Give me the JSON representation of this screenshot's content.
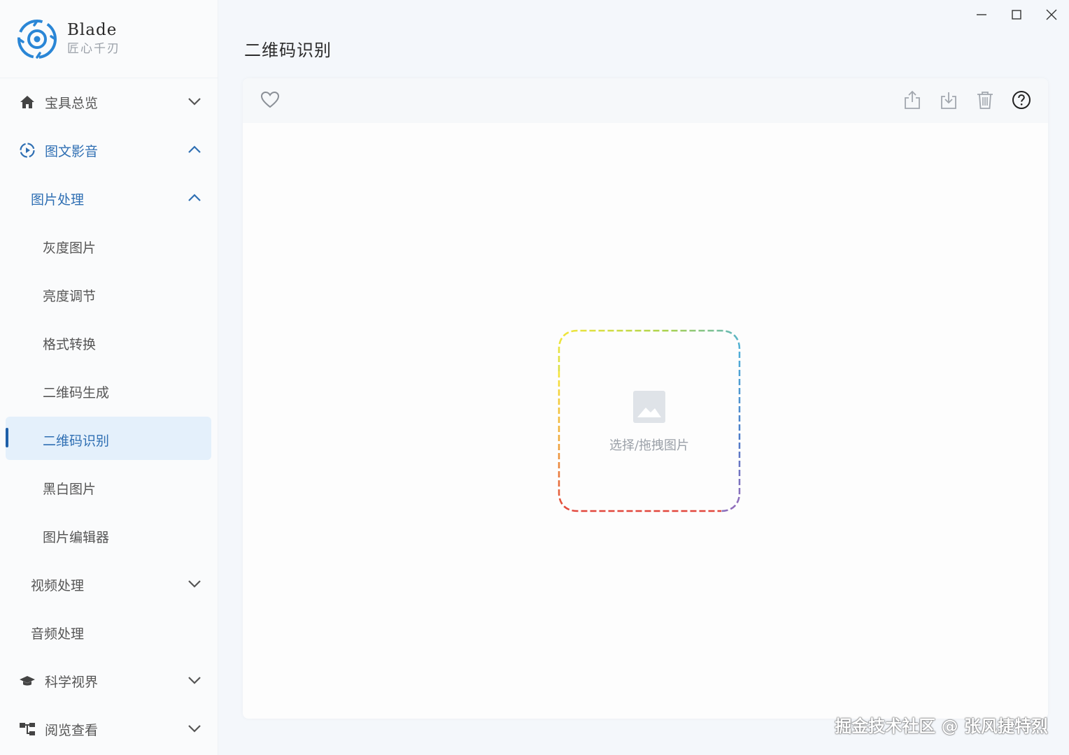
{
  "brand": {
    "name": "Blade",
    "subtitle": "匠心千刃"
  },
  "window_controls": [
    {
      "name": "minimize-icon"
    },
    {
      "name": "maximize-icon"
    },
    {
      "name": "close-icon"
    }
  ],
  "sidebar": {
    "items": [
      {
        "label": "宝具总览",
        "icon": "home-icon",
        "chevron": "down"
      },
      {
        "label": "图文影音",
        "icon": "play-circle-icon",
        "chevron": "up"
      },
      {
        "label": "图片处理",
        "chevron": "up"
      },
      {
        "label": "灰度图片"
      },
      {
        "label": "亮度调节"
      },
      {
        "label": "格式转换"
      },
      {
        "label": "二维码生成"
      },
      {
        "label": "二维码识别",
        "active": true
      },
      {
        "label": "黑白图片"
      },
      {
        "label": "图片编辑器"
      },
      {
        "label": "视频处理",
        "chevron": "down"
      },
      {
        "label": "音频处理"
      },
      {
        "label": "科学视界",
        "icon": "graduation-cap-icon",
        "chevron": "down"
      },
      {
        "label": "阅览查看",
        "icon": "sitemap-icon",
        "chevron": "down"
      }
    ]
  },
  "main": {
    "title": "二维码识别",
    "toolbar": {
      "left": [
        "heart-icon"
      ],
      "right": [
        "share-icon",
        "download-icon",
        "trash-icon",
        "help-icon"
      ]
    },
    "dropzone": {
      "label": "选择/拖拽图片",
      "icon": "image-icon"
    }
  },
  "watermark": "掘金技术社区 @ 张风捷特烈",
  "colors": {
    "accent": "#2f6fb3",
    "active_bg": "#e4f0fb",
    "active_bar": "#1e5fa8"
  }
}
